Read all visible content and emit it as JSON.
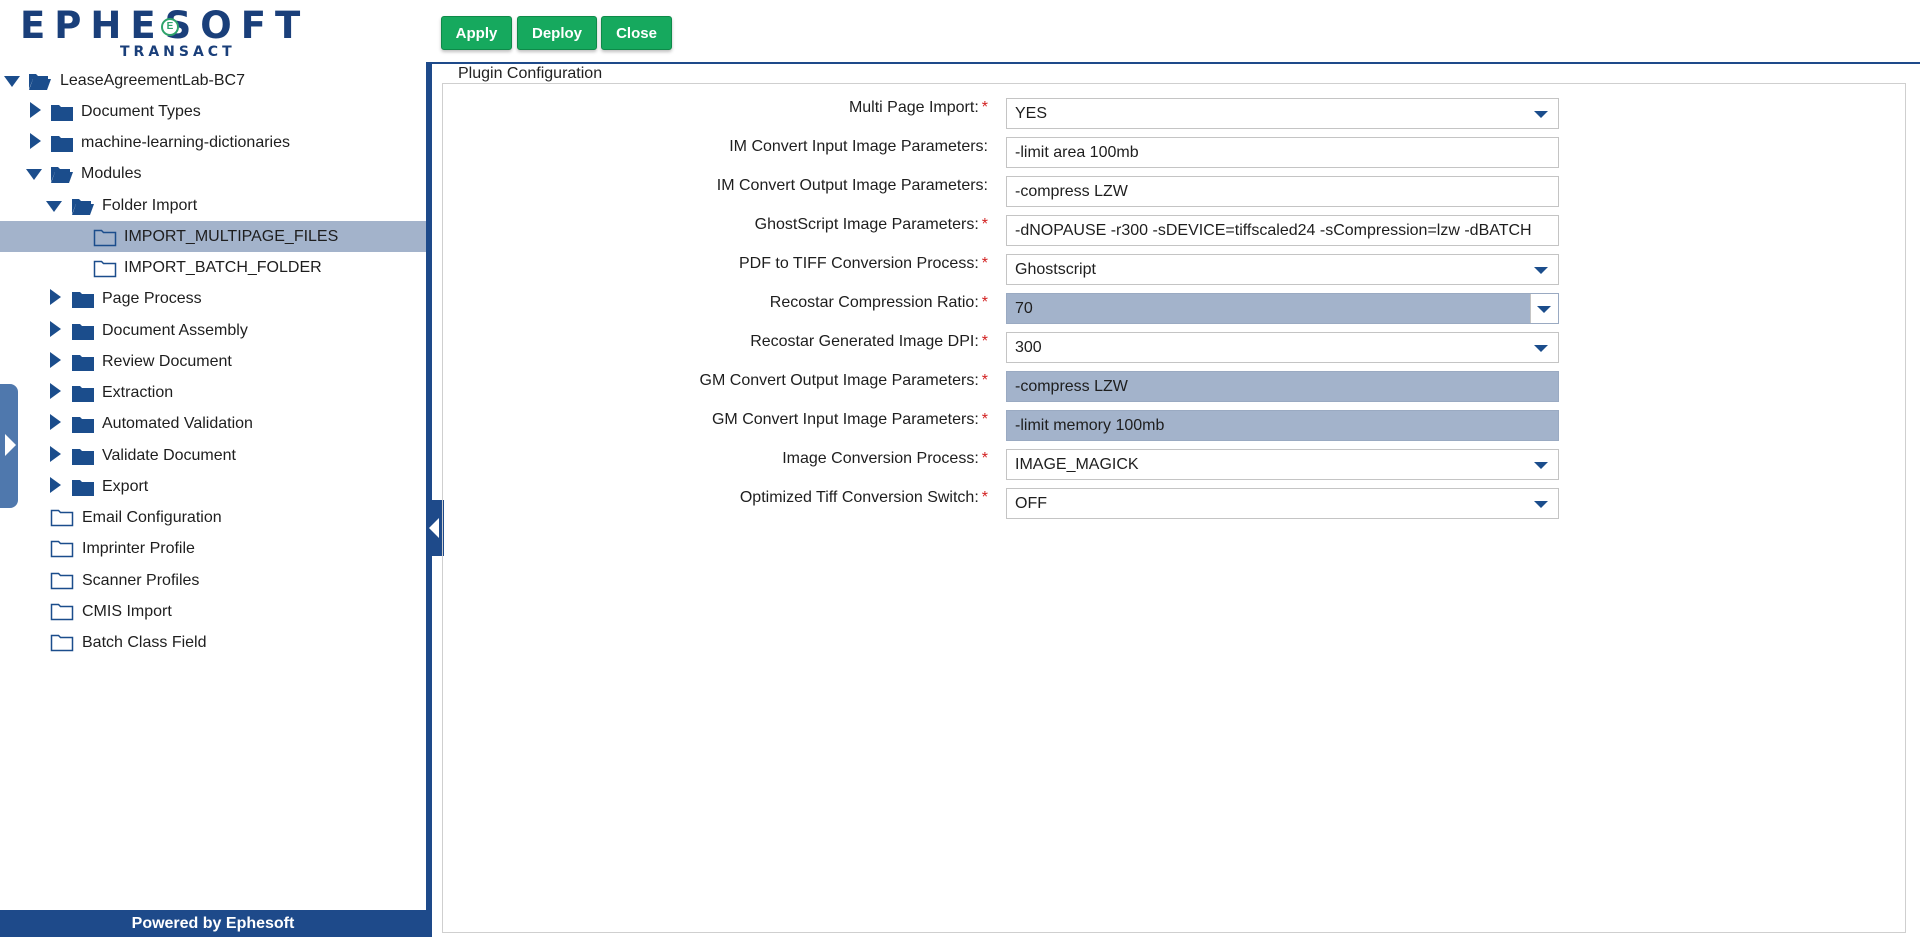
{
  "logo": {
    "brand": "EPHESOFT",
    "product": "TRANSACT",
    "badge": "E"
  },
  "toolbar": {
    "apply": "Apply",
    "deploy": "Deploy",
    "close": "Close"
  },
  "tree": {
    "root": "LeaseAgreementLab-BC7",
    "items": [
      {
        "label": "Document Types"
      },
      {
        "label": "machine-learning-dictionaries"
      },
      {
        "label": "Modules"
      },
      {
        "label": "Folder Import"
      },
      {
        "label": "IMPORT_MULTIPAGE_FILES"
      },
      {
        "label": "IMPORT_BATCH_FOLDER"
      },
      {
        "label": "Page Process"
      },
      {
        "label": "Document Assembly"
      },
      {
        "label": "Review Document"
      },
      {
        "label": "Extraction"
      },
      {
        "label": "Automated Validation"
      },
      {
        "label": "Validate Document"
      },
      {
        "label": "Export"
      },
      {
        "label": "Email Configuration"
      },
      {
        "label": "Imprinter Profile"
      },
      {
        "label": "Scanner Profiles"
      },
      {
        "label": "CMIS Import"
      },
      {
        "label": "Batch Class Field"
      }
    ]
  },
  "footer": "Powered by Ephesoft",
  "config": {
    "legend": "Plugin Configuration",
    "fields": [
      {
        "label": "Multi Page Import:",
        "value": "YES"
      },
      {
        "label": "IM Convert Input Image Parameters:",
        "value": "-limit area 100mb"
      },
      {
        "label": "IM Convert Output Image Parameters:",
        "value": "-compress LZW"
      },
      {
        "label": "GhostScript Image Parameters:",
        "value": "-dNOPAUSE -r300 -sDEVICE=tiffscaled24 -sCompression=lzw -dBATCH"
      },
      {
        "label": "PDF to TIFF Conversion Process:",
        "value": "Ghostscript"
      },
      {
        "label": "Recostar Compression Ratio:",
        "value": "70"
      },
      {
        "label": "Recostar Generated Image DPI:",
        "value": "300"
      },
      {
        "label": "GM Convert Output Image Parameters:",
        "value": "-compress LZW"
      },
      {
        "label": "GM Convert Input Image Parameters:",
        "value": "-limit memory 100mb"
      },
      {
        "label": "Image Conversion Process:",
        "value": "IMAGE_MAGICK"
      },
      {
        "label": "Optimized Tiff Conversion Switch:",
        "value": "OFF"
      }
    ],
    "required_mark": "*"
  },
  "colors": {
    "accent": "#1e4a8a",
    "button": "#16a95e",
    "selected": "#a3b3cb",
    "required": "#d21f1f"
  },
  "icons": {
    "folder": "folder-icon",
    "open_folder": "open-folder-icon",
    "expand": "caret-right-icon",
    "collapse": "caret-down-icon",
    "dropdown": "chevron-down-icon"
  }
}
